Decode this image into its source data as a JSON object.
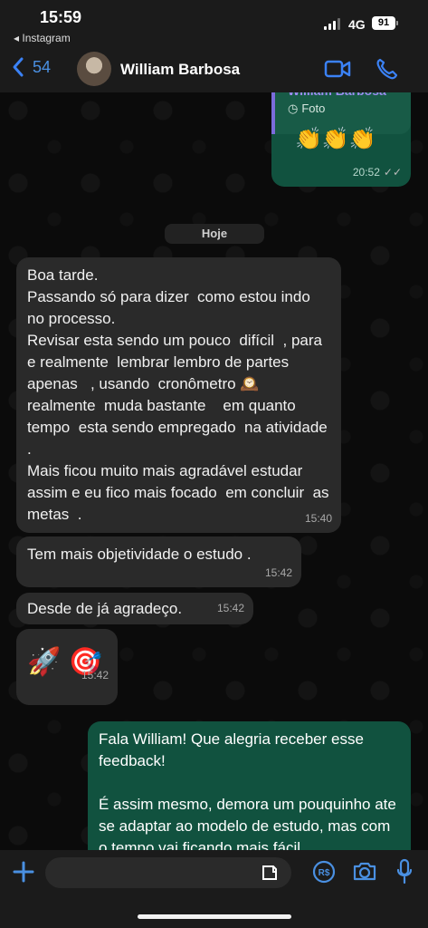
{
  "status": {
    "time": "15:59",
    "back_app": "◂ Instagram",
    "network": "4G",
    "battery": "91"
  },
  "header": {
    "back_count": "54",
    "contact_name": "William Barbosa"
  },
  "quoted": {
    "name": "William Barbosa",
    "type": "Foto",
    "emoji": "👏👏👏",
    "time": "20:52"
  },
  "day_label": "Hoje",
  "messages": [
    {
      "text": "Boa tarde.\nPassando só para dizer  como estou indo no processo.\nRevisar esta sendo um pouco  difícil  , para e realmente  lembrar lembro de partes apenas   , usando  cronômetro 🕰️  realmente  muda bastante    em quanto tempo  esta sendo empregado  na atividade  .\nMais ficou muito mais agradável estudar assim e eu fico mais focado  em concluir  as metas  .",
      "time": "15:40"
    },
    {
      "text": "Tem mais objetividade  o estudo .",
      "time": "15:42"
    },
    {
      "text": "Desde de já agradeço.",
      "time": "15:42"
    },
    {
      "text": "🚀  🎯",
      "time": "15:42"
    },
    {
      "text": "Fala William! Que alegria receber esse feedback!\n\nÉ assim mesmo, demora um pouquinho ate se adaptar ao modelo de estudo, mas com o tempo vai ficando mais fácil",
      "time": ""
    }
  ],
  "composer": {
    "placeholder": ""
  },
  "colors": {
    "accent": "#4a90e2",
    "incoming": "#2a2a2a",
    "outgoing": "#11523f"
  }
}
